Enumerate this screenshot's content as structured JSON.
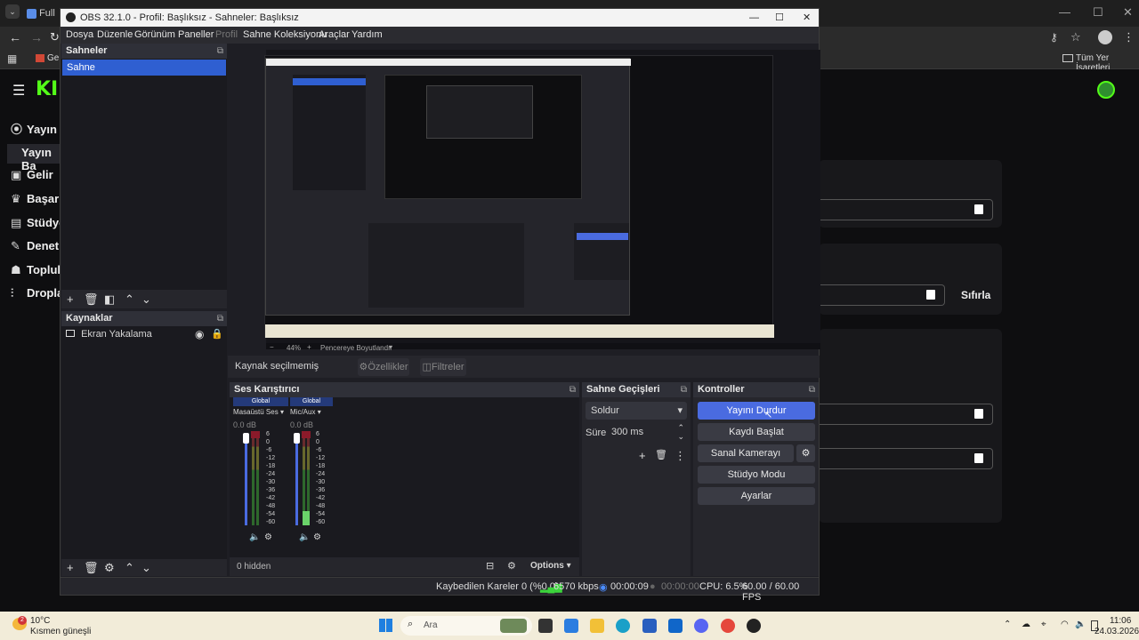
{
  "browser": {
    "tab_label": "Full H",
    "bookmark_left": "Gele",
    "bookmark_right": "Tüm Yer İşaretleri",
    "controls": {
      "minimize": "—",
      "maximize": "☐",
      "close": "✕"
    }
  },
  "site": {
    "logo": "KI",
    "nav": [
      "Yayın",
      "Yayın Ba",
      "Gelir",
      "Başarı",
      "Stüdyo",
      "Denetl",
      "Toplul",
      "Dropla"
    ],
    "reset_label": "Sıfırla"
  },
  "obs": {
    "title": "OBS 32.1.0 - Profil: Başlıksız - Sahneler: Başlıksız",
    "menu": [
      "Dosya",
      "Düzenle",
      "Görünüm",
      "Paneller",
      "Profil",
      "Sahne Koleksiyonu",
      "Araçlar",
      "Yardım"
    ],
    "scenes": {
      "title": "Sahneler",
      "items": [
        "Sahne"
      ]
    },
    "sources": {
      "title": "Kaynaklar",
      "items": [
        "Ekran Yakalama"
      ]
    },
    "preview": {
      "zoom": "44%",
      "fit_label": "Pencereye Boyutlandır"
    },
    "context_bar": {
      "no_source": "Kaynak seçilmemiş",
      "properties": "Özellikler",
      "filters": "Filtreler"
    },
    "mixer": {
      "title": "Ses Karıştırıcı",
      "channels": [
        {
          "badge": "Global",
          "name": "Masaüstü Ses",
          "db": "0.0 dB"
        },
        {
          "badge": "Global",
          "name": "Mic/Aux",
          "db": "0.0 dB"
        }
      ],
      "ticks": [
        "6",
        "0",
        "-6",
        "-12",
        "-18",
        "-24",
        "-30",
        "-36",
        "-42",
        "-48",
        "-54",
        "-60"
      ],
      "hidden_label": "0 hidden",
      "options_label": "Options"
    },
    "transitions": {
      "title": "Sahne Geçişleri",
      "type": "Soldur",
      "duration_label": "Süre",
      "duration_value": "300 ms"
    },
    "controls": {
      "title": "Kontroller",
      "stop_stream": "Yayını Durdur",
      "start_recording": "Kaydı Başlat",
      "virtual_camera": "Sanal Kamerayı Başlat",
      "studio_mode": "Stüdyo Modu",
      "settings": "Ayarlar"
    },
    "status": {
      "dropped": "Kaybedilen Kareler 0 (%0.0)",
      "bitrate": "6570 kbps",
      "stream_time": "00:00:09",
      "rec_time": "00:00:00",
      "cpu": "CPU: 6.5%",
      "fps": "60.00 / 60.00 FPS"
    }
  },
  "taskbar": {
    "weather_temp": "10°C",
    "weather_desc": "Kısmen güneşli",
    "search_placeholder": "Ara",
    "time": "11:06",
    "date": "24.03.2026",
    "notification_count": "2"
  }
}
